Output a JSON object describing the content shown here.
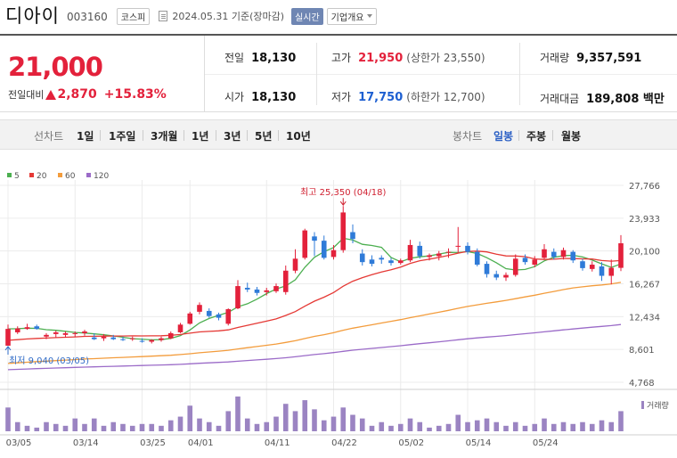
{
  "header": {
    "stock_name": "디아이",
    "stock_code": "003160",
    "market": "코스피",
    "date_text": "2024.05.31 기준(장마감)",
    "realtime_label": "실시간",
    "overview_label": "기업개요"
  },
  "price": {
    "current": "21,000",
    "change_label": "전일대비",
    "change": "2,870",
    "change_pct": "+15.83%"
  },
  "info": {
    "prev_close_label": "전일",
    "prev_close": "18,130",
    "high_label": "고가",
    "high": "21,950",
    "upper_limit": "(상한가 23,550)",
    "volume_label": "거래량",
    "volume": "9,357,591",
    "open_label": "시가",
    "open": "18,130",
    "low_label": "저가",
    "low": "17,750",
    "lower_limit": "(하한가 12,700)",
    "amount_label": "거래대금",
    "amount": "189,808 백만"
  },
  "toolbar": {
    "line_chart_label": "선차트",
    "periods": [
      "1일",
      "1주일",
      "3개월",
      "1년",
      "3년",
      "5년",
      "10년"
    ],
    "candle_chart_label": "봉차트",
    "candle_periods": [
      "일봉",
      "주봉",
      "월봉"
    ],
    "active_candle": "일봉"
  },
  "colors": {
    "up": "#e3213b",
    "down": "#2f7bd8",
    "ma5": "#4caf50",
    "ma20": "#e53935",
    "ma60": "#f39c3c",
    "ma120": "#9b6bc8",
    "volume": "#9b84c2"
  },
  "chart_data": {
    "type": "candlestick",
    "legend": [
      {
        "name": "5",
        "color": "#4caf50"
      },
      {
        "name": "20",
        "color": "#e53935"
      },
      {
        "name": "60",
        "color": "#f39c3c"
      },
      {
        "name": "120",
        "color": "#9b6bc8"
      }
    ],
    "y_ticks": [
      "27,766",
      "23,933",
      "20,100",
      "16,267",
      "12,434",
      "8,601",
      "4,768"
    ],
    "ylim": [
      4768,
      27766
    ],
    "x_ticks": [
      "03/05",
      "03/14",
      "03/25",
      "04/01",
      "04/11",
      "04/22",
      "05/02",
      "05/14",
      "05/24"
    ],
    "max_annotation": "최고 25,350 (04/18)",
    "min_annotation": "최저 9,040 (03/05)",
    "volume_legend": "거래량",
    "candles": [
      {
        "d": "03/05",
        "o": 9040,
        "h": 11500,
        "l": 9040,
        "c": 11000,
        "v": 0.65
      },
      {
        "d": "03/06",
        "o": 10600,
        "h": 11300,
        "l": 10400,
        "c": 11050,
        "v": 0.25
      },
      {
        "d": "03/07",
        "o": 11000,
        "h": 11600,
        "l": 10900,
        "c": 11200,
        "v": 0.15
      },
      {
        "d": "03/08",
        "o": 11300,
        "h": 11500,
        "l": 10900,
        "c": 11000,
        "v": 0.1
      },
      {
        "d": "03/11",
        "o": 10100,
        "h": 10500,
        "l": 9800,
        "c": 10300,
        "v": 0.25
      },
      {
        "d": "03/12",
        "o": 10400,
        "h": 10800,
        "l": 10000,
        "c": 10600,
        "v": 0.2
      },
      {
        "d": "03/13",
        "o": 10300,
        "h": 10700,
        "l": 10000,
        "c": 10500,
        "v": 0.15
      },
      {
        "d": "03/14",
        "o": 10400,
        "h": 10700,
        "l": 10100,
        "c": 10500,
        "v": 0.35
      },
      {
        "d": "03/15",
        "o": 10500,
        "h": 10900,
        "l": 10200,
        "c": 10700,
        "v": 0.2
      },
      {
        "d": "03/18",
        "o": 10000,
        "h": 10500,
        "l": 9700,
        "c": 9800,
        "v": 0.35
      },
      {
        "d": "03/19",
        "o": 9900,
        "h": 10400,
        "l": 9600,
        "c": 10100,
        "v": 0.15
      },
      {
        "d": "03/20",
        "o": 10000,
        "h": 10300,
        "l": 9700,
        "c": 9800,
        "v": 0.25
      },
      {
        "d": "03/21",
        "o": 9800,
        "h": 10100,
        "l": 9600,
        "c": 9700,
        "v": 0.2
      },
      {
        "d": "03/22",
        "o": 9800,
        "h": 10100,
        "l": 9600,
        "c": 9900,
        "v": 0.15
      },
      {
        "d": "03/25",
        "o": 9600,
        "h": 9900,
        "l": 9400,
        "c": 9500,
        "v": 0.2
      },
      {
        "d": "03/26",
        "o": 9500,
        "h": 9800,
        "l": 9300,
        "c": 9700,
        "v": 0.2
      },
      {
        "d": "03/27",
        "o": 9700,
        "h": 10100,
        "l": 9500,
        "c": 9900,
        "v": 0.15
      },
      {
        "d": "03/28",
        "o": 9900,
        "h": 10700,
        "l": 9800,
        "c": 10500,
        "v": 0.3
      },
      {
        "d": "03/29",
        "o": 10600,
        "h": 11700,
        "l": 10500,
        "c": 11500,
        "v": 0.4
      },
      {
        "d": "04/01",
        "o": 11600,
        "h": 13000,
        "l": 11500,
        "c": 12800,
        "v": 0.7
      },
      {
        "d": "04/02",
        "o": 13000,
        "h": 14100,
        "l": 12700,
        "c": 13800,
        "v": 0.35
      },
      {
        "d": "04/03",
        "o": 13100,
        "h": 13400,
        "l": 12300,
        "c": 12500,
        "v": 0.25
      },
      {
        "d": "04/04",
        "o": 12700,
        "h": 12900,
        "l": 12000,
        "c": 12300,
        "v": 0.15
      },
      {
        "d": "04/05",
        "o": 11600,
        "h": 13400,
        "l": 11400,
        "c": 13300,
        "v": 0.55
      },
      {
        "d": "04/08",
        "o": 13400,
        "h": 16700,
        "l": 13300,
        "c": 16000,
        "v": 0.95
      },
      {
        "d": "04/09",
        "o": 15800,
        "h": 16400,
        "l": 15300,
        "c": 15600,
        "v": 0.35
      },
      {
        "d": "04/10",
        "o": 15600,
        "h": 15900,
        "l": 14900,
        "c": 15200,
        "v": 0.2
      },
      {
        "d": "04/11",
        "o": 15300,
        "h": 15800,
        "l": 14900,
        "c": 15500,
        "v": 0.25
      },
      {
        "d": "04/12",
        "o": 15400,
        "h": 16300,
        "l": 15200,
        "c": 16000,
        "v": 0.4
      },
      {
        "d": "04/15",
        "o": 15300,
        "h": 18400,
        "l": 15000,
        "c": 17800,
        "v": 0.75
      },
      {
        "d": "04/16",
        "o": 17800,
        "h": 20300,
        "l": 17500,
        "c": 19200,
        "v": 0.55
      },
      {
        "d": "04/17",
        "o": 19300,
        "h": 22700,
        "l": 19100,
        "c": 22500,
        "v": 0.85
      },
      {
        "d": "04/18",
        "o": 21800,
        "h": 22300,
        "l": 19500,
        "c": 21300,
        "v": 0.6
      },
      {
        "d": "04/19",
        "o": 21300,
        "h": 21900,
        "l": 19100,
        "c": 19300,
        "v": 0.3
      },
      {
        "d": "04/22",
        "o": 19400,
        "h": 20800,
        "l": 19100,
        "c": 20200,
        "v": 0.4
      },
      {
        "d": "04/23",
        "o": 20200,
        "h": 25350,
        "l": 19900,
        "c": 24600,
        "v": 0.65
      },
      {
        "d": "04/24",
        "o": 22300,
        "h": 23200,
        "l": 21000,
        "c": 21500,
        "v": 0.45
      },
      {
        "d": "04/25",
        "o": 19800,
        "h": 20300,
        "l": 18400,
        "c": 18800,
        "v": 0.35
      },
      {
        "d": "04/26",
        "o": 19100,
        "h": 19600,
        "l": 18300,
        "c": 18600,
        "v": 0.15
      },
      {
        "d": "04/29",
        "o": 19300,
        "h": 19600,
        "l": 18600,
        "c": 19100,
        "v": 0.25
      },
      {
        "d": "04/30",
        "o": 19000,
        "h": 19300,
        "l": 18400,
        "c": 18700,
        "v": 0.15
      },
      {
        "d": "05/02",
        "o": 18700,
        "h": 19200,
        "l": 18500,
        "c": 19000,
        "v": 0.2
      },
      {
        "d": "05/03",
        "o": 19000,
        "h": 21400,
        "l": 18800,
        "c": 20800,
        "v": 0.35
      },
      {
        "d": "05/07",
        "o": 20700,
        "h": 21200,
        "l": 19200,
        "c": 19500,
        "v": 0.25
      },
      {
        "d": "05/08",
        "o": 19400,
        "h": 19800,
        "l": 19000,
        "c": 19600,
        "v": 0.1
      },
      {
        "d": "05/09",
        "o": 19500,
        "h": 20100,
        "l": 19000,
        "c": 19800,
        "v": 0.15
      },
      {
        "d": "05/10",
        "o": 19900,
        "h": 20400,
        "l": 19300,
        "c": 20000,
        "v": 0.2
      },
      {
        "d": "05/13",
        "o": 20600,
        "h": 22900,
        "l": 19900,
        "c": 20700,
        "v": 0.45
      },
      {
        "d": "05/14",
        "o": 20700,
        "h": 21100,
        "l": 19700,
        "c": 20000,
        "v": 0.25
      },
      {
        "d": "05/16",
        "o": 20000,
        "h": 20400,
        "l": 18300,
        "c": 18500,
        "v": 0.3
      },
      {
        "d": "05/17",
        "o": 18600,
        "h": 18900,
        "l": 17000,
        "c": 17400,
        "v": 0.35
      },
      {
        "d": "05/20",
        "o": 17400,
        "h": 17800,
        "l": 16700,
        "c": 17000,
        "v": 0.25
      },
      {
        "d": "05/21",
        "o": 17000,
        "h": 17600,
        "l": 16600,
        "c": 17300,
        "v": 0.15
      },
      {
        "d": "05/22",
        "o": 17300,
        "h": 19700,
        "l": 17100,
        "c": 19200,
        "v": 0.25
      },
      {
        "d": "05/23",
        "o": 19300,
        "h": 19700,
        "l": 18500,
        "c": 18800,
        "v": 0.15
      },
      {
        "d": "05/24",
        "o": 18500,
        "h": 19500,
        "l": 18200,
        "c": 19100,
        "v": 0.2
      },
      {
        "d": "05/27",
        "o": 19300,
        "h": 20900,
        "l": 19100,
        "c": 20300,
        "v": 0.35
      },
      {
        "d": "05/28",
        "o": 20000,
        "h": 20400,
        "l": 19100,
        "c": 19400,
        "v": 0.2
      },
      {
        "d": "05/29",
        "o": 19400,
        "h": 20500,
        "l": 19100,
        "c": 20200,
        "v": 0.25
      },
      {
        "d": "05/29b",
        "o": 20000,
        "h": 20200,
        "l": 18700,
        "c": 19000,
        "v": 0.2
      },
      {
        "d": "05/30a",
        "o": 18900,
        "h": 19200,
        "l": 17800,
        "c": 18100,
        "v": 0.25
      },
      {
        "d": "05/30b",
        "o": 18000,
        "h": 18900,
        "l": 17700,
        "c": 18500,
        "v": 0.2
      },
      {
        "d": "05/30c",
        "o": 18300,
        "h": 18800,
        "l": 16600,
        "c": 17200,
        "v": 0.3
      },
      {
        "d": "05/30",
        "o": 17200,
        "h": 19100,
        "l": 16200,
        "c": 18130,
        "v": 0.25
      },
      {
        "d": "05/31",
        "o": 18130,
        "h": 21950,
        "l": 17750,
        "c": 21000,
        "v": 0.55
      }
    ]
  }
}
